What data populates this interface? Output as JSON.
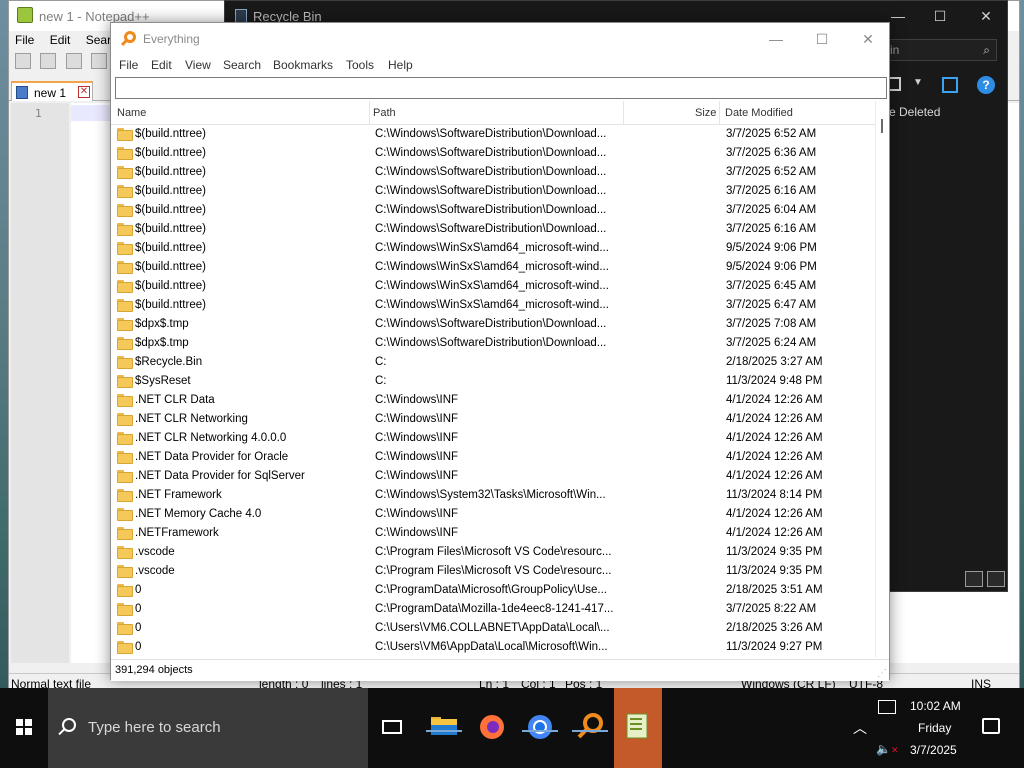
{
  "notepad": {
    "title": "new 1 - Notepad++",
    "menu": [
      "File",
      "Edit",
      "Search"
    ],
    "tab_label": "new 1",
    "line_number": "1",
    "status": {
      "file_type": "Normal text file",
      "length": "length : 0",
      "lines": "lines : 1",
      "ln": "Ln : 1",
      "col": "Col : 1",
      "pos": "Pos : 1",
      "eol": "Windows (CR LF)",
      "encoding": "UTF-8",
      "mode": "INS"
    }
  },
  "recycle_bin": {
    "title": "Recycle Bin",
    "search_placeholder": "in",
    "column_deleted": "e Deleted",
    "controls": {
      "min": "—",
      "max": "☐",
      "close": "✕"
    }
  },
  "everything": {
    "title": "Everything",
    "controls": {
      "min": "—",
      "max": "☐",
      "close": "✕"
    },
    "menu": [
      "File",
      "Edit",
      "View",
      "Search",
      "Bookmarks",
      "Tools",
      "Help"
    ],
    "search_value": "",
    "columns": {
      "name": "Name",
      "path": "Path",
      "size": "Size",
      "date": "Date Modified"
    },
    "rows": [
      {
        "name": "$(build.nttree)",
        "path": "C:\\Windows\\SoftwareDistribution\\Download...",
        "size": "",
        "date": "3/7/2025 6:52 AM"
      },
      {
        "name": "$(build.nttree)",
        "path": "C:\\Windows\\SoftwareDistribution\\Download...",
        "size": "",
        "date": "3/7/2025 6:36 AM"
      },
      {
        "name": "$(build.nttree)",
        "path": "C:\\Windows\\SoftwareDistribution\\Download...",
        "size": "",
        "date": "3/7/2025 6:52 AM"
      },
      {
        "name": "$(build.nttree)",
        "path": "C:\\Windows\\SoftwareDistribution\\Download...",
        "size": "",
        "date": "3/7/2025 6:16 AM"
      },
      {
        "name": "$(build.nttree)",
        "path": "C:\\Windows\\SoftwareDistribution\\Download...",
        "size": "",
        "date": "3/7/2025 6:04 AM"
      },
      {
        "name": "$(build.nttree)",
        "path": "C:\\Windows\\SoftwareDistribution\\Download...",
        "size": "",
        "date": "3/7/2025 6:16 AM"
      },
      {
        "name": "$(build.nttree)",
        "path": "C:\\Windows\\WinSxS\\amd64_microsoft-wind...",
        "size": "",
        "date": "9/5/2024 9:06 PM"
      },
      {
        "name": "$(build.nttree)",
        "path": "C:\\Windows\\WinSxS\\amd64_microsoft-wind...",
        "size": "",
        "date": "9/5/2024 9:06 PM"
      },
      {
        "name": "$(build.nttree)",
        "path": "C:\\Windows\\WinSxS\\amd64_microsoft-wind...",
        "size": "",
        "date": "3/7/2025 6:45 AM"
      },
      {
        "name": "$(build.nttree)",
        "path": "C:\\Windows\\WinSxS\\amd64_microsoft-wind...",
        "size": "",
        "date": "3/7/2025 6:47 AM"
      },
      {
        "name": "$dpx$.tmp",
        "path": "C:\\Windows\\SoftwareDistribution\\Download...",
        "size": "",
        "date": "3/7/2025 7:08 AM"
      },
      {
        "name": "$dpx$.tmp",
        "path": "C:\\Windows\\SoftwareDistribution\\Download...",
        "size": "",
        "date": "3/7/2025 6:24 AM"
      },
      {
        "name": "$Recycle.Bin",
        "path": "C:",
        "size": "",
        "date": "2/18/2025 3:27 AM"
      },
      {
        "name": "$SysReset",
        "path": "C:",
        "size": "",
        "date": "11/3/2024 9:48 PM"
      },
      {
        "name": ".NET CLR Data",
        "path": "C:\\Windows\\INF",
        "size": "",
        "date": "4/1/2024 12:26 AM"
      },
      {
        "name": ".NET CLR Networking",
        "path": "C:\\Windows\\INF",
        "size": "",
        "date": "4/1/2024 12:26 AM"
      },
      {
        "name": ".NET CLR Networking 4.0.0.0",
        "path": "C:\\Windows\\INF",
        "size": "",
        "date": "4/1/2024 12:26 AM"
      },
      {
        "name": ".NET Data Provider for Oracle",
        "path": "C:\\Windows\\INF",
        "size": "",
        "date": "4/1/2024 12:26 AM"
      },
      {
        "name": ".NET Data Provider for SqlServer",
        "path": "C:\\Windows\\INF",
        "size": "",
        "date": "4/1/2024 12:26 AM"
      },
      {
        "name": ".NET Framework",
        "path": "C:\\Windows\\System32\\Tasks\\Microsoft\\Win...",
        "size": "",
        "date": "11/3/2024 8:14 PM"
      },
      {
        "name": ".NET Memory Cache 4.0",
        "path": "C:\\Windows\\INF",
        "size": "",
        "date": "4/1/2024 12:26 AM"
      },
      {
        "name": ".NETFramework",
        "path": "C:\\Windows\\INF",
        "size": "",
        "date": "4/1/2024 12:26 AM"
      },
      {
        "name": ".vscode",
        "path": "C:\\Program Files\\Microsoft VS Code\\resourc...",
        "size": "",
        "date": "11/3/2024 9:35 PM"
      },
      {
        "name": ".vscode",
        "path": "C:\\Program Files\\Microsoft VS Code\\resourc...",
        "size": "",
        "date": "11/3/2024 9:35 PM"
      },
      {
        "name": "0",
        "path": "C:\\ProgramData\\Microsoft\\GroupPolicy\\Use...",
        "size": "",
        "date": "2/18/2025 3:51 AM"
      },
      {
        "name": "0",
        "path": "C:\\ProgramData\\Mozilla-1de4eec8-1241-417...",
        "size": "",
        "date": "3/7/2025 8:22 AM"
      },
      {
        "name": "0",
        "path": "C:\\Users\\VM6.COLLABNET\\AppData\\Local\\...",
        "size": "",
        "date": "2/18/2025 3:26 AM"
      },
      {
        "name": "0",
        "path": "C:\\Users\\VM6\\AppData\\Local\\Microsoft\\Win...",
        "size": "",
        "date": "11/3/2024 9:27 PM"
      }
    ],
    "status_count": "391,294 objects"
  },
  "taskbar": {
    "search_placeholder": "Type here to search",
    "apps": [
      {
        "name": "File Explorer",
        "icon": "folder-icon",
        "color": "#f5c542",
        "running": true
      },
      {
        "name": "Firefox",
        "icon": "firefox-icon",
        "color": "#ff7139",
        "running": false
      },
      {
        "name": "Chrome",
        "icon": "chrome-icon",
        "color": "#4285f4",
        "running": true
      },
      {
        "name": "Everything",
        "icon": "everything-icon",
        "color": "#f08a1c",
        "running": true
      },
      {
        "name": "Notepad++",
        "icon": "notepadpp-icon",
        "color": "#9bc53d",
        "running": true,
        "active": true
      }
    ],
    "clock": {
      "time": "10:02 AM",
      "day": "Friday",
      "date": "3/7/2025"
    }
  }
}
